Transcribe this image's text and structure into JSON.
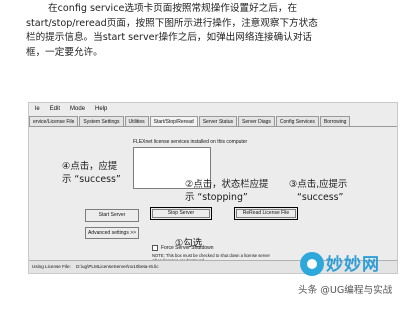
{
  "instructions": {
    "lines": [
      "在config service选项卡页面按照常规操作设置好之后，在",
      "start/stop/reread页面，按照下图所示进行操作，注意观察下方状态",
      "栏的提示信息。当start server操作之后，如弹出网络连接确认对话",
      "框，一定要允许。"
    ]
  },
  "window": {
    "menu": [
      "le",
      "Edit",
      "Mode",
      "Help"
    ],
    "tabs": [
      "ervice/License File",
      "System Settings",
      "Utilities",
      "Start/Stop/Reread",
      "Server Status",
      "Server Diags",
      "Config Services",
      "Borrowing"
    ],
    "active_tab": "Start/Stop/Reread",
    "list_caption": "FLEXnet license services installed on this computer",
    "buttons": {
      "start_server": "Start Server",
      "stop_server": "Stop Server",
      "reread": "ReRead License File",
      "advanced": "Advanced settings >>"
    },
    "force_checkbox_label": "Force Server Shutdown",
    "force_checked": false,
    "note_lines": [
      "NOTE:  This box must be checked to shut down a license server",
      "when licenses are borrowed."
    ],
    "status_label": "Using License File:",
    "status_value": "D:\\ug\\PLMLicenseServer\\nx10beta-r6.lic"
  },
  "annotations": {
    "step4_line1": "④点击，应提",
    "step4_line2": "示 “success”",
    "step2_line1": "②点击，状态栏应提",
    "step2_line2": "示 “stopping”",
    "step3_line1": "③点击,应提示",
    "step3_line2": "“success”",
    "step1": "①勾选"
  },
  "watermark": {
    "title": "妙妙网",
    "subtitle": "头条 @UG编程与实战",
    "brand_color": "#2e9ed6"
  }
}
